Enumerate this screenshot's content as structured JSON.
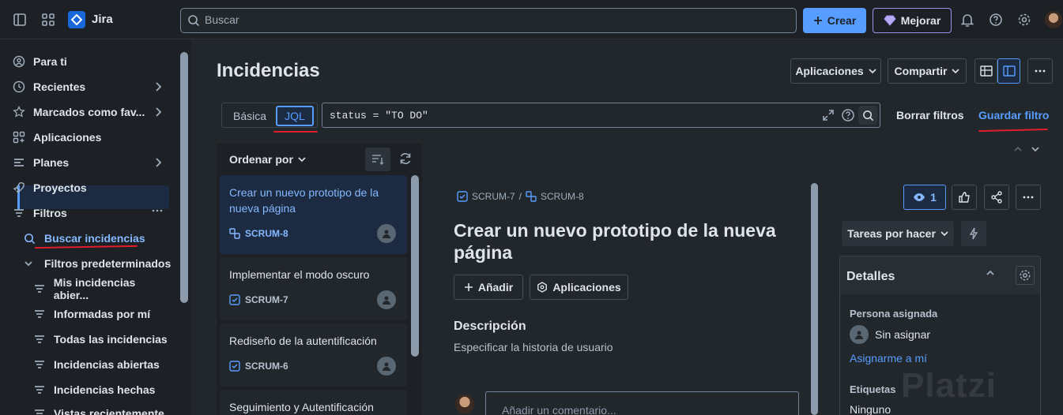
{
  "topbar": {
    "app_name": "Jira",
    "search_placeholder": "Buscar",
    "create_label": "Crear",
    "upgrade_label": "Mejorar"
  },
  "sidebar": {
    "items": [
      {
        "label": "Para ti",
        "icon": "user-circle-icon"
      },
      {
        "label": "Recientes",
        "icon": "clock-icon"
      },
      {
        "label": "Marcados como fav...",
        "icon": "star-icon"
      },
      {
        "label": "Aplicaciones",
        "icon": "apps-icon"
      },
      {
        "label": "Planes",
        "icon": "plans-icon"
      },
      {
        "label": "Proyectos",
        "icon": "rocket-icon"
      },
      {
        "label": "Filtros",
        "icon": "filter-icon"
      }
    ],
    "active_item": "Buscar incidencias",
    "group_label": "Filtros predeterminados",
    "sub_items": [
      "Mis incidencias abier...",
      "Informadas por mí",
      "Todas las incidencias",
      "Incidencias abiertas",
      "Incidencias hechas",
      "Vistas recientemente"
    ]
  },
  "header": {
    "title": "Incidencias",
    "apps_label": "Aplicaciones",
    "share_label": "Compartir"
  },
  "filter": {
    "basic_label": "Básica",
    "jql_label": "JQL",
    "query": "status = \"TO DO\"",
    "clear_label": "Borrar filtros",
    "save_label": "Guardar filtro"
  },
  "list": {
    "sort_label": "Ordenar por",
    "cards": [
      {
        "title": "Crear un nuevo prototipo de la nueva página",
        "key": "SCRUM-8",
        "selected": true
      },
      {
        "title": "Implementar el modo oscuro",
        "key": "SCRUM-7",
        "selected": false
      },
      {
        "title": "Rediseño de la autentificación",
        "key": "SCRUM-6",
        "selected": false
      },
      {
        "title": "Seguimiento y Autentificación",
        "key": "",
        "selected": false
      }
    ]
  },
  "detail": {
    "parent_key": "SCRUM-7",
    "issue_key": "SCRUM-8",
    "title": "Crear un nuevo prototipo de la nueva página",
    "add_label": "Añadir",
    "apps_label": "Aplicaciones",
    "description_heading": "Descripción",
    "description_text": "Especificar la historia de usuario",
    "comment_placeholder": "Añadir un comentario..."
  },
  "side": {
    "watchers": "1",
    "status": "Tareas por hacer",
    "details_title": "Detalles",
    "assignee_label": "Persona asignada",
    "assignee_value": "Sin asignar",
    "assign_me": "Asignarme a mí",
    "labels_label": "Etiquetas",
    "labels_value": "Ninguno"
  },
  "watermark": "Platzi",
  "colors": {
    "accent": "#579dff",
    "annotation_red": "#e11d2b",
    "upgrade_border": "#9f8fef"
  }
}
